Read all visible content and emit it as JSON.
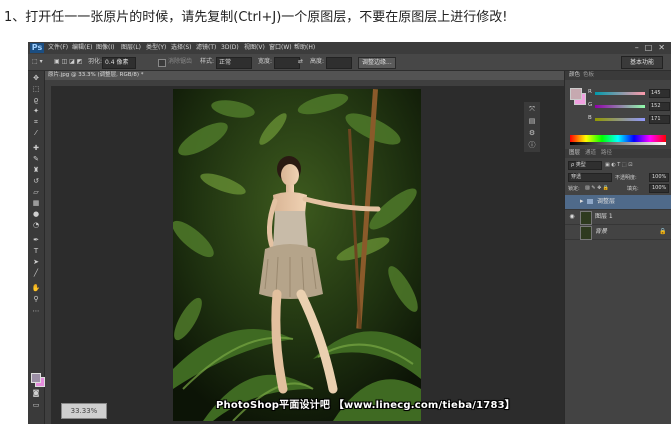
{
  "caption": "1、打开任一一张原片的时候，请先复制(Ctrl+J)一个原图层，不要在原图层上进行修改!",
  "app": {
    "logo": "Ps"
  },
  "menu": [
    "文件(F)",
    "编辑(E)",
    "图像(I)",
    "图层(L)",
    "类型(Y)",
    "选择(S)",
    "滤镜(T)",
    "3D(D)",
    "视图(V)",
    "窗口(W)",
    "帮助(H)"
  ],
  "options": {
    "feather_label": "羽化:",
    "feather_value": "0.4 像素",
    "antialias_label": "消除锯齿",
    "style_label": "样式:",
    "style_value": "正常",
    "width_label": "宽度:",
    "height_label": "高度:",
    "refine_button": "调整边缘...",
    "workspace": "基本功能"
  },
  "document": {
    "tab_title": "原片.jpg @ 33.3% (调整层, RGB/8) *"
  },
  "panels": {
    "color_tabs": [
      "颜色",
      "色板"
    ],
    "rgb": [
      {
        "label": "R",
        "value": "145"
      },
      {
        "label": "G",
        "value": "152"
      },
      {
        "label": "B",
        "value": "171"
      }
    ],
    "layers_tabs": [
      "图层",
      "通道",
      "路径"
    ],
    "kind_label": "ρ 类型",
    "blend_mode": "穿透",
    "opacity_label": "不透明度:",
    "opacity_value": "100%",
    "lock_label": "锁定:",
    "fill_label": "填充:",
    "fill_value": "100%",
    "layers": [
      {
        "name": "调整层",
        "type": "group",
        "selected": true
      },
      {
        "name": "图层 1",
        "type": "layer",
        "selected": false
      },
      {
        "name": "背景",
        "type": "background",
        "selected": false
      }
    ]
  },
  "status": {
    "zoom": "33.33%"
  },
  "watermark": "PhotoShop平面设计吧 【www.linecg.com/tieba/1783】",
  "colors": {
    "ps_bg": "#535353",
    "menubar": "#3c3c3c",
    "panel": "#434343",
    "selected_layer": "#4f6a8a",
    "fg_swatch": "#9c8fa6",
    "bg_swatch": "#e58cdc"
  },
  "icons": [
    "move-tool-icon",
    "marquee-tool-icon",
    "lasso-tool-icon",
    "magic-wand-icon",
    "crop-tool-icon",
    "eyedropper-icon",
    "healing-brush-icon",
    "brush-tool-icon",
    "clone-stamp-icon",
    "history-brush-icon",
    "eraser-icon",
    "gradient-icon",
    "blur-icon",
    "dodge-icon",
    "pen-tool-icon",
    "type-tool-icon",
    "path-select-icon",
    "shape-tool-icon",
    "hand-tool-icon",
    "zoom-tool-icon"
  ]
}
